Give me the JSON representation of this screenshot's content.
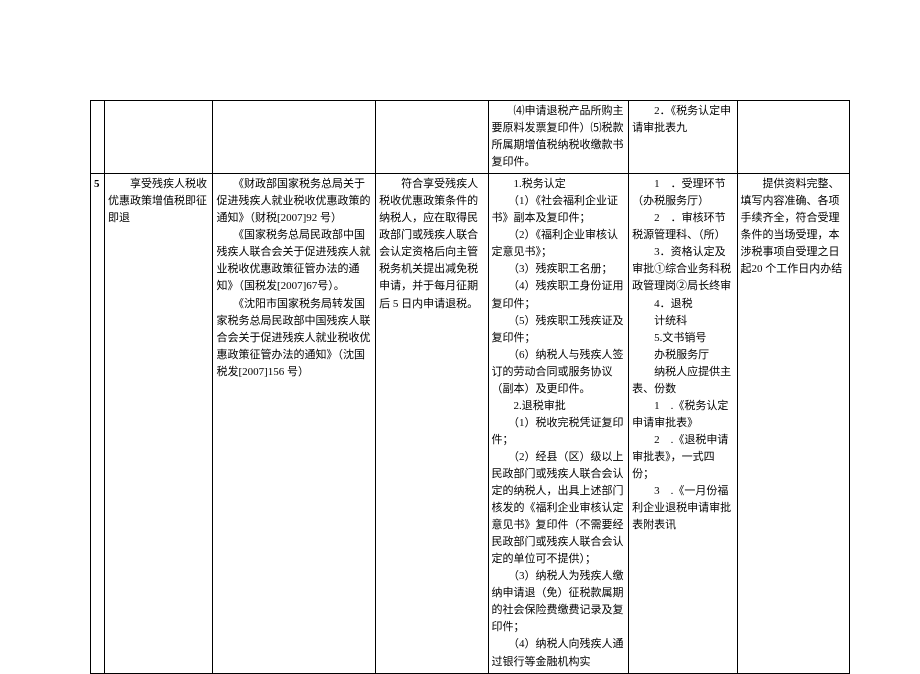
{
  "row0": {
    "c4": "　　⑷申请退税产品所购主要原料发票复印件）⑸税款所属期增值税纳税收缴款书复印件。",
    "c5": "　　2．《税务认定申请审批表九"
  },
  "row1": {
    "num": "5",
    "c1": "　　享受残疾人税收优惠政策增值税即征即退",
    "c2_p1": "　　《财政部国家税务总局关于促进残疾人就业税收优惠政策的通知》（财税[2007]92 号）",
    "c2_p2": "　　《国家税务总局民政部中国残疾人联合会关于促进残疾人就业税收优惠政策征管办法的通知》（国税发[2007]67号）。",
    "c2_p3": "　　《沈阳市国家税务局转发国家税务总局民政部中国残疾人联合会关于促进残疾人就业税收优惠政策征管办法的通知》（沈国税发[2007]156 号）",
    "c3": "　　符合享受残疾人税收优惠政策条件的纳税人，应在取得民政部门或残疾人联合会认定资格后向主管税务机关提出减免税申请，并于每月征期后 5 日内申请退税。",
    "c4_l1": "　　1.税务认定",
    "c4_l2": "　　（1）《社会福利企业证书》副本及复印件；",
    "c4_l3": "　　（2）《福利企业审核认定意见书》；",
    "c4_l4": "　　（3）残疾职工名册；",
    "c4_l5": "　　（4）残疾职工身份证用复印件；",
    "c4_l6": "　　（5）残疾职工残疾证及复印件；",
    "c4_l7": "　　（6）纳税人与残疾人签订的劳动合同或服务协议（副本）及更印件。",
    "c4_l8": "　　2.退税审批",
    "c4_l9": "　　（1）税收完税凭证复印件；",
    "c4_l10": "　　（2）经县（区）级以上民政部门或残疾人联合会认定的纳税人，出具上述部门核发的《福利企业审核认定意见书》复印件（不需要经民政部门或残疾人联合会认定的单位可不提供）；",
    "c4_l11": "　　（3）纳税人为残疾人缴纳申请退（免）征税款属期的社会保险费缴费记录及复印件；",
    "c4_l12": "　　（4）纳税人向残疾人通过银行等金融机构实",
    "c5_l1": "　　1　．受理环节（办税服务厅）",
    "c5_l2": "　　2　．审核环节税源管理科、（所）",
    "c5_l3": "　　3．资格认定及审批①综合业务科税政管理岗②局长终审",
    "c5_l4": "　　4．退税",
    "c5_l5": "　　计统科",
    "c5_l6": "　　5.文书销号",
    "c5_l7": "　　办税服务厅",
    "c5_l8": "　　纳税人应提供主表、份数",
    "c5_l9": "　　1　.《税务认定申请审批表》",
    "c5_l10": "　　2　.《退税申请审批表》，一式四份；",
    "c5_l11": "　　3　.《一月份福利企业退税申请审批表附表讯",
    "c6": "　　提供资料完整、填写内容准确、各项手续齐全，符合受理条件的当场受理，本涉税事项自受理之日起20 个工作日内办结"
  }
}
